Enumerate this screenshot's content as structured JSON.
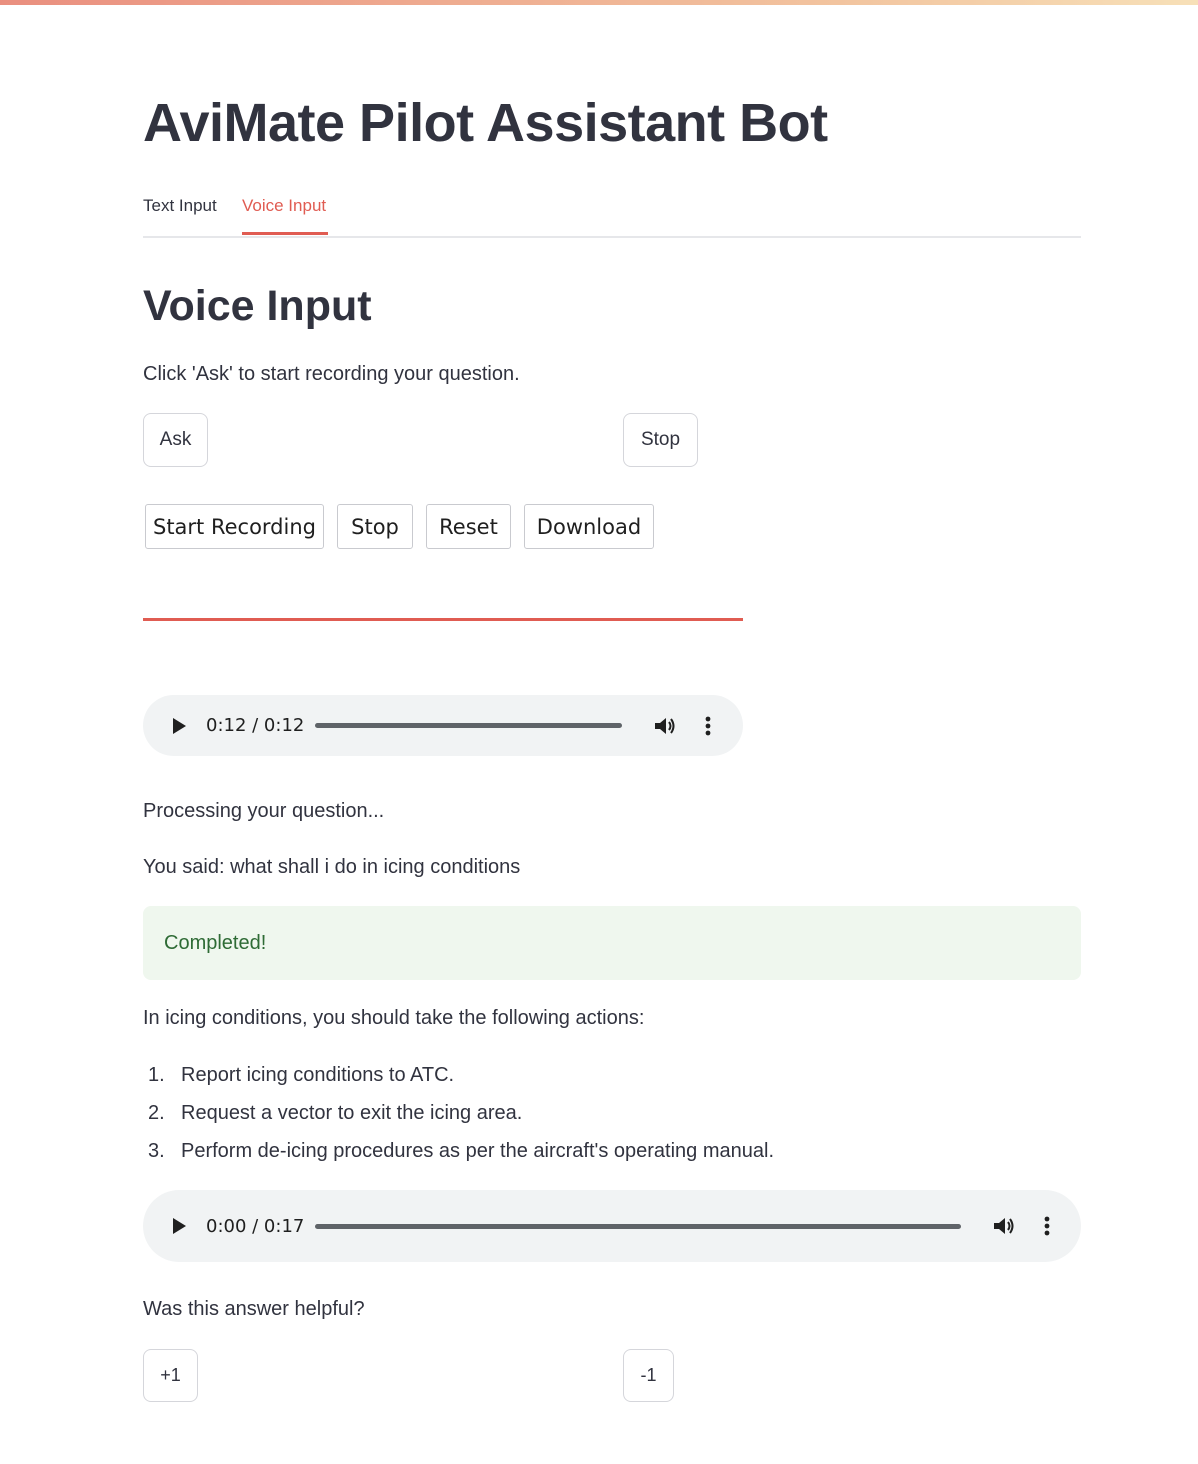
{
  "app": {
    "title": "AviMate Pilot Assistant Bot"
  },
  "tabs": [
    {
      "label": "Text Input",
      "active": false
    },
    {
      "label": "Voice Input",
      "active": true
    }
  ],
  "voice": {
    "heading": "Voice Input",
    "instruction": "Click 'Ask' to start recording your question.",
    "ask_label": "Ask",
    "stop_label": "Stop"
  },
  "recorder": {
    "start_label": "Start Recording",
    "stop_label": "Stop",
    "reset_label": "Reset",
    "download_label": "Download"
  },
  "recorded_audio": {
    "time": "0:12 / 0:12",
    "progress": 1.0
  },
  "status": {
    "processing": "Processing your question...",
    "you_said": "You said: what shall i do in icing conditions",
    "completed": "Completed!"
  },
  "answer": {
    "intro": "In icing conditions, you should take the following actions:",
    "steps": [
      {
        "num": "1.",
        "text": "Report icing conditions to ATC."
      },
      {
        "num": "2.",
        "text": "Request a vector to exit the icing area."
      },
      {
        "num": "3.",
        "text": "Perform de-icing procedures as per the aircraft's operating manual."
      }
    ]
  },
  "answer_audio": {
    "time": "0:00 / 0:17",
    "progress": 0.0
  },
  "feedback": {
    "question": "Was this answer helpful?",
    "up_label": "+1",
    "down_label": "-1"
  },
  "colors": {
    "accent": "#e05c52",
    "success_bg": "#eff7ee",
    "success_text": "#2e6b35",
    "audio_bg": "#f1f3f4"
  },
  "icons": {
    "play": "play-icon",
    "volume": "volume-icon",
    "more": "more-vertical-icon"
  }
}
